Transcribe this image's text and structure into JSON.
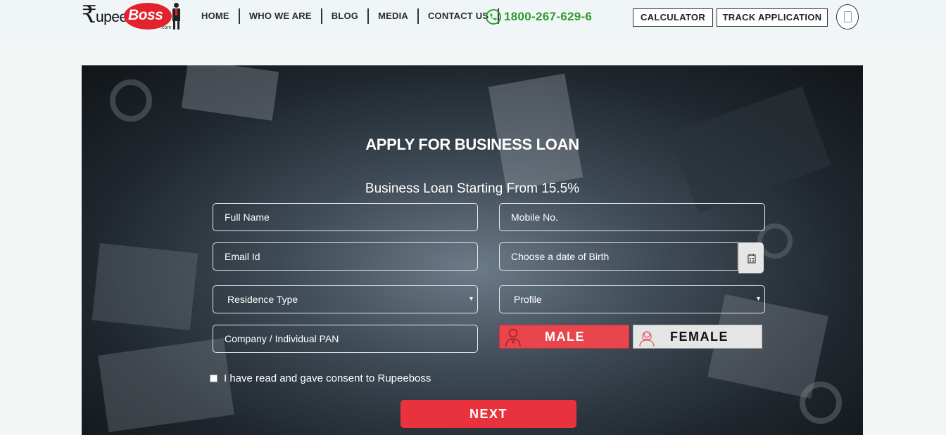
{
  "brand": {
    "logo_rupee": "₹",
    "logo_upee": "upee",
    "logo_boss": "Boss",
    "logo_dotcom": ".com",
    "accent": "#e2222c"
  },
  "nav": {
    "items": [
      "HOME",
      "WHO WE ARE",
      "BLOG",
      "MEDIA",
      "CONTACT US"
    ]
  },
  "phone": {
    "icon": "phone-icon",
    "number": "1800-267-629-6",
    "color": "#2f9a2f"
  },
  "header_buttons": {
    "calculator": "CALCULATOR",
    "track": "TRACK APPLICATION",
    "menu_icon": "mobile-icon"
  },
  "form": {
    "title": "APPLY FOR BUSINESS LOAN",
    "subtitle": "Business Loan Starting From 15.5%",
    "full_name_placeholder": "Full Name",
    "mobile_placeholder": "Mobile No.",
    "email_placeholder": "Email Id",
    "dob_placeholder": "Choose a date of Birth",
    "residence_type": "Residence Type",
    "profile": "Profile",
    "pan_placeholder": "Company / Individual PAN",
    "male": "MALE",
    "female": "FEMALE",
    "consent": "I have read and gave consent to Rupeeboss",
    "next": "NEXT",
    "dropdown_arrow": "▾"
  }
}
